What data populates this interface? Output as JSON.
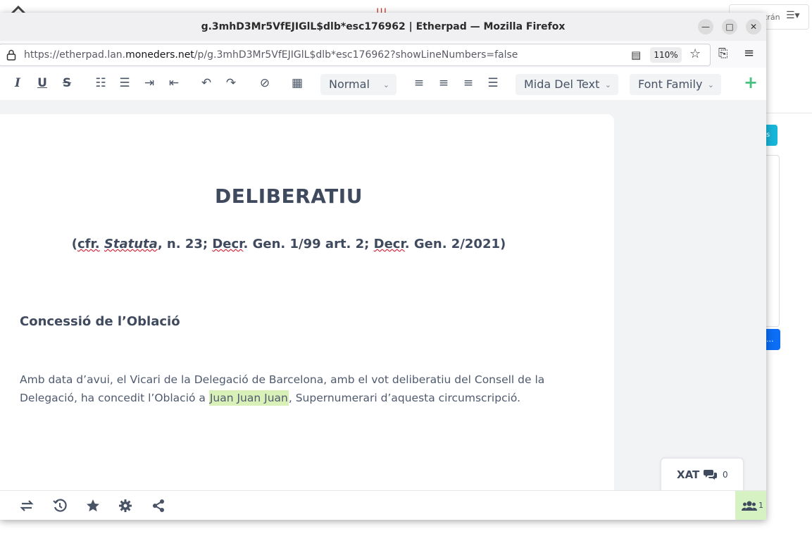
{
  "background": {
    "user_label": "trán",
    "panel_button_text": "s",
    "panel_button2_text": "..."
  },
  "window": {
    "title": "g.3mhD3Mr5VfEJIGlL$dlb*esc176962 | Etherpad — Mozilla Firefox",
    "url_prefix": "https://etherpad.lan.",
    "url_domain": "moneders.net",
    "url_suffix": "/p/g.3mhD3Mr5VfEJIGlL$dlb*esc176962?showLineNumbers=false",
    "zoom": "110%"
  },
  "toolbar": {
    "paragraph_style": "Normal",
    "font_size_label": "Mida Del Text",
    "font_family_label": "Font Family",
    "colors": {
      "icon": "#485365",
      "plus": "#47c27e"
    }
  },
  "document": {
    "title": "DELIBERATIU",
    "subtitle_parts": {
      "open": "(",
      "cfr": "cfr.",
      "space1": " ",
      "statuta": "Statuta",
      "mid1": ", n. 23; ",
      "decr1": "Decr",
      "mid2": ". Gen. 1/99 art. 2; ",
      "decr2": "Decr",
      "end": ". Gen. 2/2021)"
    },
    "heading": "Concessió de l’Oblació",
    "paragraph_before": "Amb data d’avui, el Vicari de la Delegació de Barcelona, amb el vot deliberatiu del Consell de la Delegació, ha concedit l’Oblació a ",
    "highlighted_name": "Juan Juan Juan",
    "paragraph_after": ", Supernumerari d’aquesta circumscripció.",
    "highlight_color": "#d9f0b8"
  },
  "chat": {
    "label": "XAT",
    "count": "0"
  },
  "users": {
    "count": "1"
  }
}
